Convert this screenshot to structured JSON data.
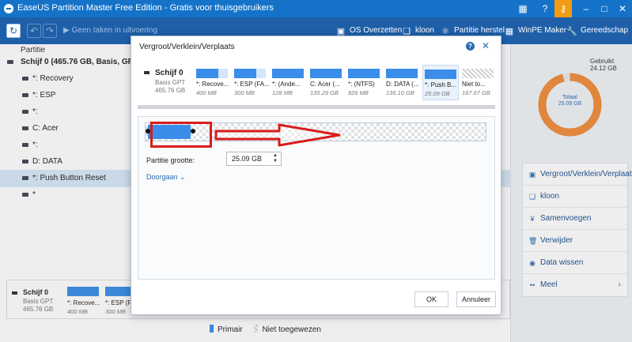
{
  "window": {
    "title": "EaseUS Partition Master Free Edition - Gratis voor thuisgebruikers",
    "buttons": [
      "grid-icon",
      "help-icon",
      "key-icon",
      "minimize-icon",
      "maximize-icon",
      "close-icon"
    ]
  },
  "toolbar": {
    "pending": "Geen taken in uitvoering",
    "items": [
      {
        "icon": "monitor-icon",
        "label": "OS Overzetten"
      },
      {
        "icon": "clone-icon",
        "label": "kloon"
      },
      {
        "icon": "recovery-icon",
        "label": "Partitie herstel"
      },
      {
        "icon": "windows-icon",
        "label": "WinPE Maker"
      },
      {
        "icon": "wrench-icon",
        "label": "Gereedschap"
      }
    ]
  },
  "left": {
    "column_header": "Partitie",
    "disk": "Schijf 0 (465.76 GB, Basis, GPT)",
    "partitions": [
      "*: Recovery",
      "*: ESP",
      "*:",
      "C: Acer",
      "*:",
      "D: DATA",
      "*: Push Button Reset",
      "*"
    ],
    "selected_index": 6
  },
  "bottom_map": {
    "disk_name": "Schijf 0",
    "disk_type": "Basis GPT",
    "disk_size": "465.76 GB",
    "parts": [
      {
        "name": "*: Recove...",
        "size": "400 MB"
      },
      {
        "name": "*: ESP (FA",
        "size": "300 MB"
      }
    ]
  },
  "legend": {
    "primary": "Primair",
    "unallocated": "Niet toegewezen"
  },
  "right": {
    "used_label": "Gebruikt",
    "used_value": "24.12 GB",
    "total_label": "Totaal",
    "total_value": "25.09 GB",
    "used_fraction": 0.961,
    "actions": [
      {
        "icon": "resize-icon",
        "label": "Vergroot/Verklein/Verplaats"
      },
      {
        "icon": "clone-icon",
        "label": "kloon"
      },
      {
        "icon": "merge-icon",
        "label": "Samenvoegen"
      },
      {
        "icon": "trash-icon",
        "label": "Verwijder"
      },
      {
        "icon": "wipe-icon",
        "label": "Data wissen"
      },
      {
        "icon": "more-icon",
        "label": "Meel"
      }
    ]
  },
  "modal": {
    "title": "Vergroot/Verklein/Verplaats",
    "disk_name": "Schijf 0",
    "disk_type": "Basis GPT",
    "disk_size": "465.76 GB",
    "parts": [
      {
        "name": "*: Recove...",
        "size": "400 MB",
        "kind": "primary"
      },
      {
        "name": "*: ESP (FA...",
        "size": "300 MB",
        "kind": "primary"
      },
      {
        "name": "*: (Ande...",
        "size": "128 MB",
        "kind": "primary"
      },
      {
        "name": "C: Acer (...",
        "size": "135.29 GB",
        "kind": "primary"
      },
      {
        "name": "*: (NTFS)",
        "size": "826 MB",
        "kind": "primary"
      },
      {
        "name": "D: DATA (...",
        "size": "136.10 GB",
        "kind": "primary"
      },
      {
        "name": "*: Push B...",
        "size": "25.09 GB",
        "kind": "selected"
      },
      {
        "name": "Niet to...",
        "size": "167.67 GB",
        "kind": "unallocated"
      }
    ],
    "size_label": "Partitie grootte:",
    "size_value": "25.09 GB",
    "more_label": "Doorgaan",
    "ok_label": "OK",
    "cancel_label": "Annuleer",
    "annotation_color": "#d81c1c"
  }
}
